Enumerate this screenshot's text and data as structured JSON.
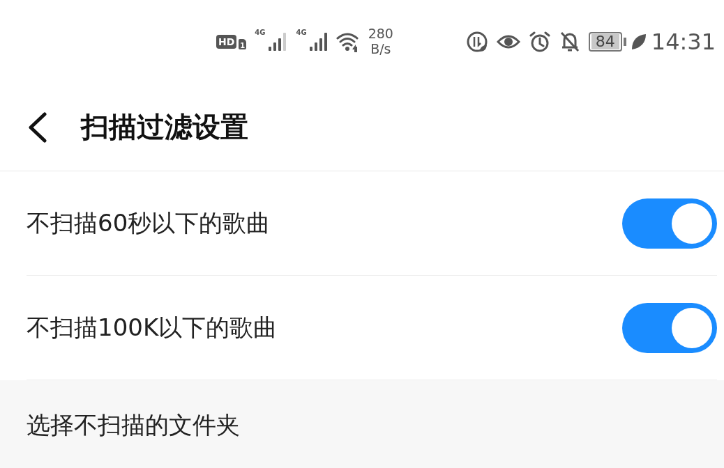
{
  "status_bar": {
    "hd_badge": "HD",
    "sim_slot": "1",
    "signals": [
      {
        "network": "4G"
      },
      {
        "network": "4G"
      }
    ],
    "speed_value": "280",
    "speed_unit": "B/s",
    "battery": "84",
    "time": "14:31"
  },
  "header": {
    "title": "扫描过滤设置"
  },
  "settings": [
    {
      "kind": "toggle",
      "label": "不扫描60秒以下的歌曲",
      "on": true
    },
    {
      "kind": "toggle",
      "label": "不扫描100K以下的歌曲",
      "on": true
    },
    {
      "kind": "link",
      "label": "选择不扫描的文件夹"
    }
  ]
}
